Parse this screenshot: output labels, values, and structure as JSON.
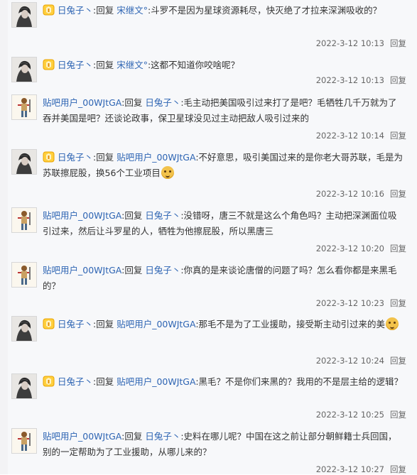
{
  "comments": [
    {
      "user": "日兔子丶",
      "vip": true,
      "avatar": "photo",
      "target": "宋继文°",
      "text": ":斗罗不是因为星球资源耗尽，快灭绝了才拉来深渊吸收的？",
      "time": "2022-3-12 10:13",
      "reply": "回复",
      "emoji": ""
    },
    {
      "user": "日兔子丶",
      "vip": true,
      "avatar": "photo",
      "target": "宋继文°",
      "text": ":这都不知道你咬啥呢？",
      "time": "2022-3-12 10:13",
      "reply": "回复",
      "emoji": ""
    },
    {
      "user": "贴吧用户_00WJtGA",
      "vip": false,
      "avatar": "figure",
      "target": "日兔子丶",
      "text": ":毛主动把美国吸引过来打了是吧？毛牺牲几千万就为了吞并美国是吧？还谈论政事，保卫星球没见过主动把敌人吸引过来的",
      "time": "2022-3-12 10:14",
      "reply": "回复",
      "emoji": ""
    },
    {
      "user": "日兔子丶",
      "vip": true,
      "avatar": "photo",
      "target": "贴吧用户_00WJtGA",
      "text": ":不好意思，吸引美国过来的是你老大哥苏联，毛是为苏联擦屁股，换56个工业项目",
      "time": "2022-3-12 10:16",
      "reply": "回复",
      "emoji": "smile"
    },
    {
      "user": "贴吧用户_00WJtGA",
      "vip": false,
      "avatar": "figure",
      "target": "日兔子丶",
      "text": ":没错呀，唐三不就是这么个角色吗？主动把深渊面位吸引过来，然后让斗罗星的人，牺牲为他擦屁股，所以黑唐三",
      "time": "2022-3-12 10:20",
      "reply": "回复",
      "emoji": ""
    },
    {
      "user": "贴吧用户_00WJtGA",
      "vip": false,
      "avatar": "figure",
      "target": "日兔子丶",
      "text": ":你真的是来谈论唐僧的问题了吗？怎么看你都是来黑毛的？",
      "time": "2022-3-12 10:23",
      "reply": "回复",
      "emoji": ""
    },
    {
      "user": "日兔子丶",
      "vip": true,
      "avatar": "photo",
      "target": "贴吧用户_00WJtGA",
      "text": ":那毛不是为了工业援助，接受斯主动引过来的美",
      "time": "2022-3-12 10:24",
      "reply": "回复",
      "emoji": "smug"
    },
    {
      "user": "日兔子丶",
      "vip": true,
      "avatar": "photo",
      "target": "贴吧用户_00WJtGA",
      "text": ":黑毛？不是你们来黑的？我用的不是层主给的逻辑？",
      "time": "2022-3-12 10:25",
      "reply": "回复",
      "emoji": ""
    },
    {
      "user": "贴吧用户_00WJtGA",
      "vip": false,
      "avatar": "figure",
      "target": "日兔子丶",
      "text": ":史料在哪儿呢？中国在这之前让部分朝鲜籍士兵回国，别的一定帮助为了工业援助，从哪儿来的？",
      "time": "2022-3-12 10:27",
      "reply": "回复",
      "emoji": ""
    }
  ]
}
